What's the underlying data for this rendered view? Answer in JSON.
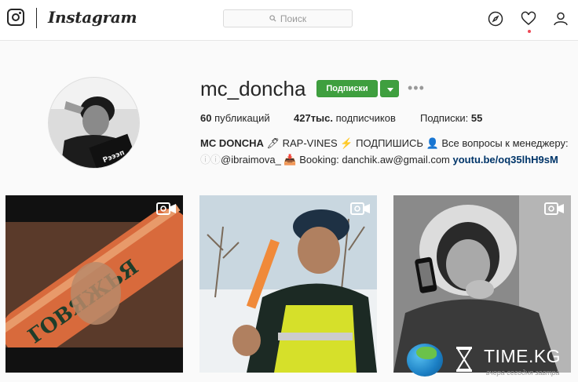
{
  "header": {
    "brand": "Instagram",
    "search_placeholder": "Поиск"
  },
  "icons": {
    "logo": "instagram-camera-icon",
    "search": "search-icon",
    "explore": "compass-icon",
    "activity": "heart-icon",
    "profile": "user-icon",
    "video": "video-camera-icon"
  },
  "profile": {
    "username": "mc_doncha",
    "follow_label": "Подписки",
    "more_label": "•••",
    "stats": {
      "posts_count": "60",
      "posts_label": " публикаций",
      "followers_count": "427тыс.",
      "followers_label": " подписчиков",
      "following_label": "Подписки: ",
      "following_count": "55"
    },
    "bio": {
      "name": "MC DONCHA",
      "line1_rest": " 🖊 RAP-VINES ⚡ ПОДПИШИСЬ 👤 Все вопросы к менеджеру:",
      "line2_faded": "ⓘⓘ",
      "line2_text": "@ibraimova_ 📥 Booking: danchik.aw@gmail.com ",
      "link": "youtu.be/oq35lhH9sM"
    }
  },
  "posts": [
    {
      "type": "video"
    },
    {
      "type": "video"
    },
    {
      "type": "video"
    }
  ],
  "watermark": {
    "name": "TIME.KG",
    "tagline": "вчера сегодня завтра"
  },
  "colors": {
    "follow_green": "#3f9f3f",
    "link_blue": "#003569",
    "notification_red": "#ed4956"
  }
}
